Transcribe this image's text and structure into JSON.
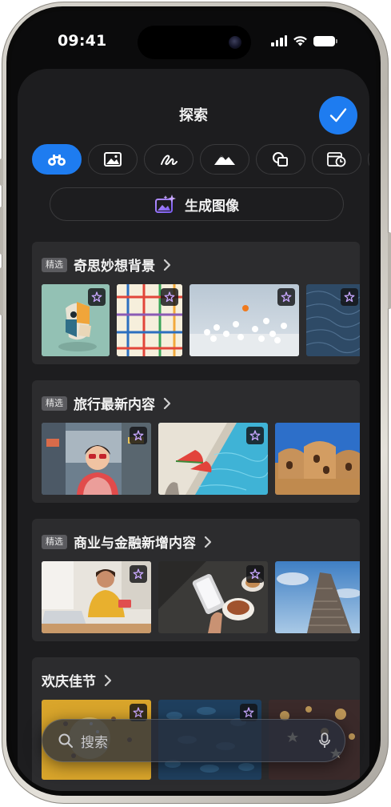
{
  "status_bar": {
    "time": "09:41"
  },
  "sheet": {
    "title": "探索",
    "done_icon": "checkmark-icon",
    "accent": "#1e7cf0"
  },
  "tabs": [
    {
      "icon": "binoculars-icon",
      "selected": true
    },
    {
      "icon": "photo-icon",
      "selected": false
    },
    {
      "icon": "sketch-icon",
      "selected": false
    },
    {
      "icon": "landscape-icon",
      "selected": false
    },
    {
      "icon": "shapes-icon",
      "selected": false
    },
    {
      "icon": "calendar-clock-icon",
      "selected": false
    }
  ],
  "generate": {
    "label": "生成图像",
    "icon": "image-sparkle-icon"
  },
  "sections": [
    {
      "badge": "精选",
      "title": "奇思妙想背景"
    },
    {
      "badge": "精选",
      "title": "旅行最新内容"
    },
    {
      "badge": "精选",
      "title": "商业与金融新增内容"
    },
    {
      "title": "欢庆佳节"
    }
  ],
  "search": {
    "placeholder": "搜索",
    "icon": "search-icon",
    "mic_icon": "microphone-icon"
  }
}
